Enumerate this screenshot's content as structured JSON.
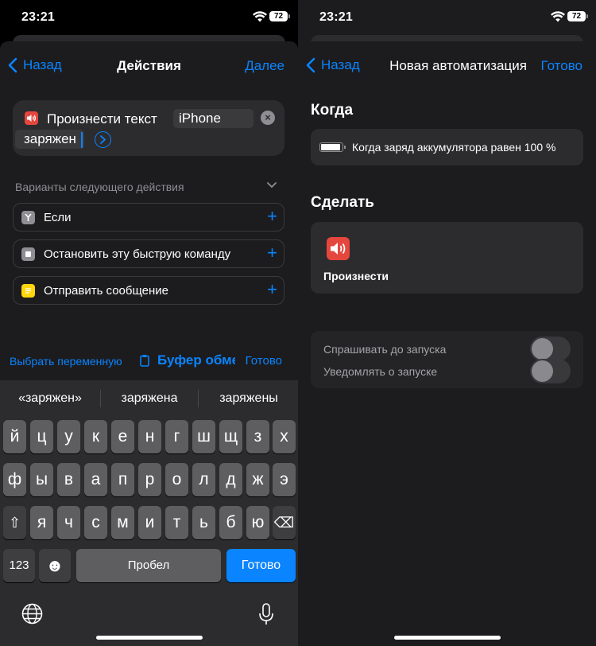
{
  "status_bar": {
    "time": "23:21",
    "battery": "72"
  },
  "left": {
    "nav": {
      "back": "Назад",
      "title": "Действия",
      "action": "Далее"
    },
    "action_card": {
      "label": "Произнести текст",
      "token": "iPhone",
      "token2": "заряжен",
      "clear": "×"
    },
    "suggestions": {
      "header": "Варианты следующего действия",
      "items": [
        {
          "label": "Если",
          "plus": "+"
        },
        {
          "label": "Остановить эту быструю команду",
          "plus": "+"
        },
        {
          "label": "Отправить сообщение",
          "plus": "+"
        }
      ]
    },
    "toolbar": {
      "variable": "Выбрать переменную",
      "clipboard": "Буфер обмена",
      "done": "Готово"
    },
    "keyboard": {
      "predictions": [
        "«заряжен»",
        "заряжена",
        "заряжены"
      ],
      "row1": [
        "й",
        "ц",
        "у",
        "к",
        "е",
        "н",
        "г",
        "ш",
        "щ",
        "з",
        "х"
      ],
      "row2": [
        "ф",
        "ы",
        "в",
        "а",
        "п",
        "р",
        "о",
        "л",
        "д",
        "ж",
        "э"
      ],
      "row3": [
        "я",
        "ч",
        "с",
        "м",
        "и",
        "т",
        "ь",
        "б",
        "ю"
      ],
      "shift": "⇧",
      "backspace": "⌫",
      "numbers": "123",
      "emoji": "☻",
      "space": "Пробел",
      "return": "Готово"
    }
  },
  "right": {
    "nav": {
      "back": "Назад",
      "title": "Новая автоматизация",
      "action": "Готово"
    },
    "when_title": "Когда",
    "when_text": "Когда заряд аккумулятора равен 100 %",
    "do_title": "Сделать",
    "do_label": "Произнести",
    "toggles": [
      {
        "label": "Спрашивать до запуска",
        "on": false
      },
      {
        "label": "Уведомлять о запуске",
        "on": false
      }
    ]
  },
  "colors": {
    "accent": "#0a84ff",
    "speak_red": "#e5463d"
  }
}
